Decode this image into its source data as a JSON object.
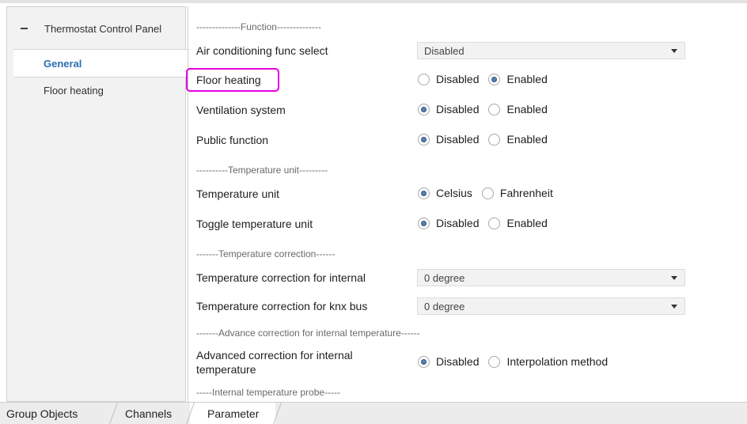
{
  "sidebar": {
    "root_label": "Thermostat Control Panel",
    "items": [
      {
        "label": "General",
        "selected": true
      },
      {
        "label": "Floor heating",
        "selected": false
      }
    ]
  },
  "sections": {
    "function": "--------------Function--------------",
    "temp_unit": "----------Temperature unit---------",
    "temp_correction": "-------Temperature correction------",
    "advance_correction": "-------Advance correction for internal temperature------",
    "internal_probe": "-----Internal temperature probe-----"
  },
  "params": {
    "air_conditioning": {
      "label": "Air conditioning func select",
      "value": "Disabled"
    },
    "floor_heating": {
      "label": "Floor heating",
      "options": [
        "Disabled",
        "Enabled"
      ],
      "selected": "Enabled"
    },
    "ventilation": {
      "label": "Ventilation system",
      "options": [
        "Disabled",
        "Enabled"
      ],
      "selected": "Disabled"
    },
    "public_function": {
      "label": "Public function",
      "options": [
        "Disabled",
        "Enabled"
      ],
      "selected": "Disabled"
    },
    "temperature_unit": {
      "label": "Temperature unit",
      "options": [
        "Celsius",
        "Fahrenheit"
      ],
      "selected": "Celsius"
    },
    "toggle_unit": {
      "label": "Toggle temperature unit",
      "options": [
        "Disabled",
        "Enabled"
      ],
      "selected": "Disabled"
    },
    "correction_internal": {
      "label": "Temperature correction for internal",
      "value": "0 degree"
    },
    "correction_knx": {
      "label": "Temperature correction for knx bus",
      "value": "0 degree"
    },
    "advanced_correction": {
      "label": "Advanced correction for internal temperature",
      "options": [
        "Disabled",
        "Interpolation method"
      ],
      "selected": "Disabled"
    }
  },
  "tabs": [
    {
      "label": "Group Objects",
      "active": false
    },
    {
      "label": "Channels",
      "active": false
    },
    {
      "label": "Parameter",
      "active": true
    }
  ],
  "colors": {
    "accent": "#2a6fb0",
    "highlight": "#e600e6",
    "radio_fill": "#5a7fae"
  }
}
